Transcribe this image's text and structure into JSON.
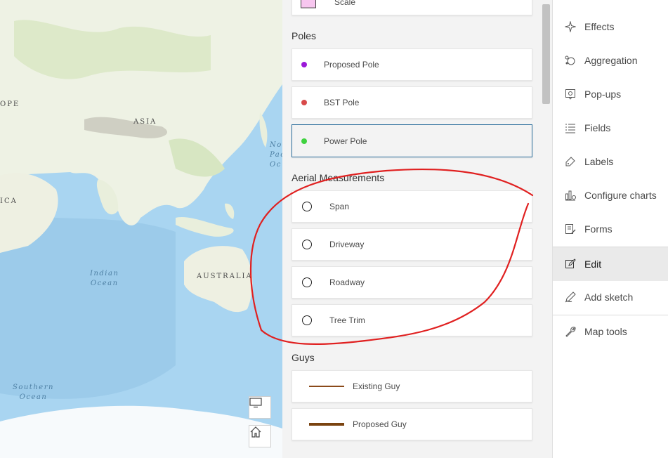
{
  "map": {
    "labels": {
      "europe": "OPE",
      "asia": "ASIA",
      "africa": "ICA",
      "australia": "AUSTRALIA",
      "north_pacific": "No\nPac\nOc"
    },
    "oceans": {
      "indian": "Indian\nOcean",
      "southern": "Southern\nOcean"
    },
    "buttons": {
      "display": "monitor-icon",
      "home": "home-icon"
    }
  },
  "panel": {
    "top_item": {
      "label": "Scale"
    },
    "poles": {
      "title": "Poles",
      "items": [
        {
          "label": "Proposed Pole",
          "color": "#9b19d8"
        },
        {
          "label": "BST Pole",
          "color": "#d84a4a"
        },
        {
          "label": "Power Pole",
          "color": "#3fd23f"
        }
      ]
    },
    "aerial": {
      "title": "Aerial Measurements",
      "items": [
        {
          "label": "Span"
        },
        {
          "label": "Driveway"
        },
        {
          "label": "Roadway"
        },
        {
          "label": "Tree Trim"
        }
      ]
    },
    "guys": {
      "title": "Guys",
      "items": [
        {
          "label": "Existing Guy",
          "color": "#8a4a1a"
        },
        {
          "label": "Proposed Guy",
          "color": "#7a4310"
        }
      ]
    }
  },
  "menu": {
    "items": [
      {
        "label": "Effects",
        "icon": "sparkle-icon"
      },
      {
        "label": "Aggregation",
        "icon": "aggregation-icon"
      },
      {
        "label": "Pop-ups",
        "icon": "popup-icon"
      },
      {
        "label": "Fields",
        "icon": "fields-icon"
      },
      {
        "label": "Labels",
        "icon": "tag-icon"
      },
      {
        "label": "Configure charts",
        "icon": "chart-icon"
      },
      {
        "label": "Forms",
        "icon": "form-icon"
      },
      {
        "label": "Edit",
        "icon": "edit-icon"
      },
      {
        "label": "Add sketch",
        "icon": "sketch-icon"
      },
      {
        "label": "Map tools",
        "icon": "wrench-icon"
      }
    ],
    "active": "Edit"
  },
  "colors": {
    "accent": "#2b6e9c",
    "annotation": "#e02020"
  }
}
